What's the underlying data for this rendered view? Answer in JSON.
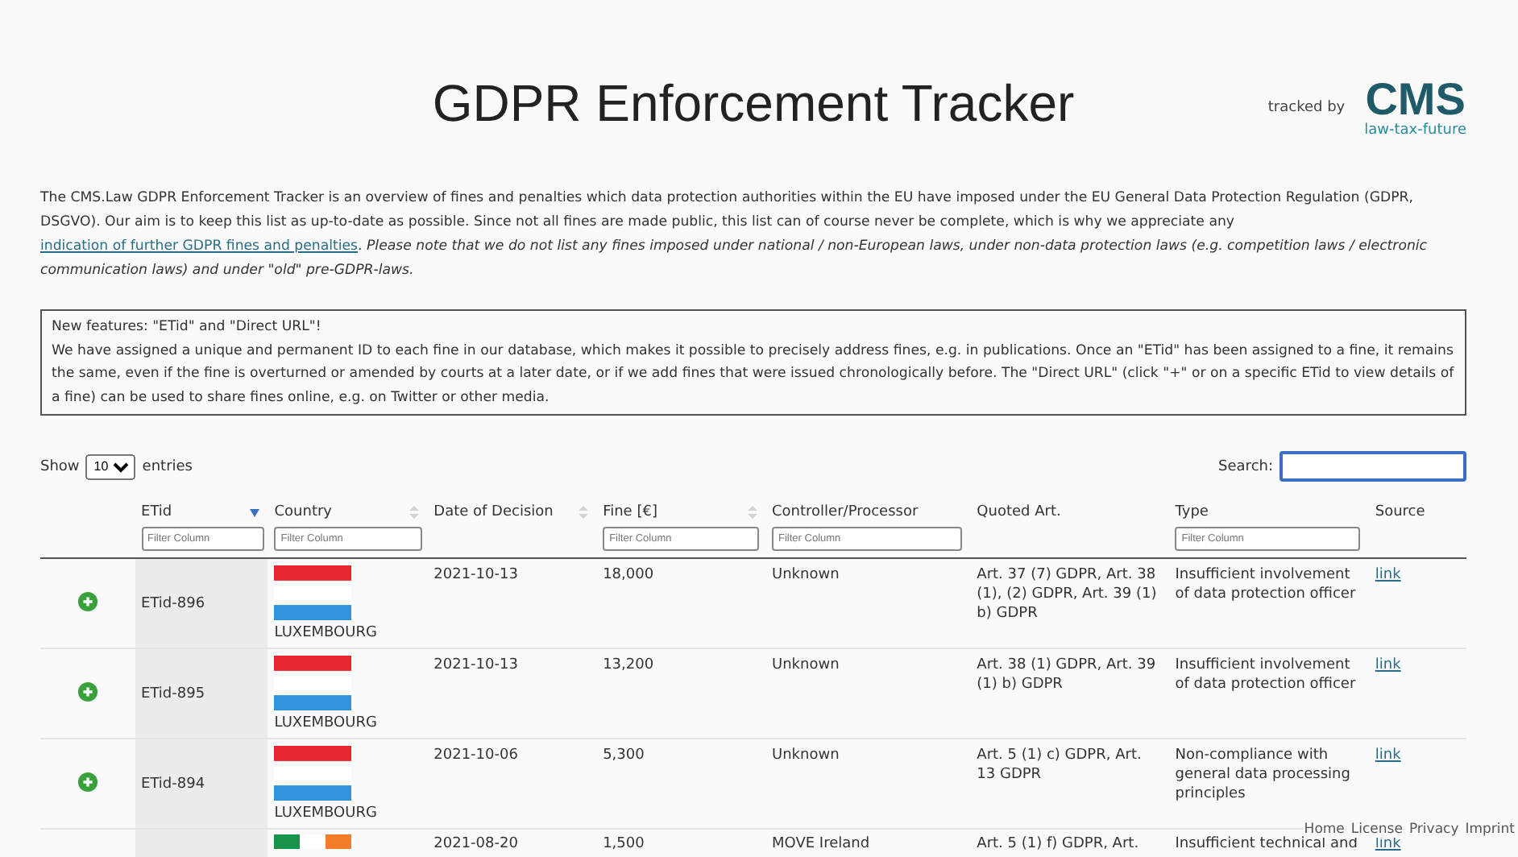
{
  "header": {
    "title": "GDPR Enforcement Tracker",
    "tracked_by": "tracked by",
    "logo": "CMS",
    "logo_tagline": "law-tax-future"
  },
  "intro": {
    "text": "The CMS.Law GDPR Enforcement Tracker is an overview of fines and penalties which data protection authorities within the EU have imposed under the EU General Data Protection Regulation (GDPR, DSGVO). Our aim is to keep this list as up-to-date as possible. Since not all fines are made public, this list can of course never be complete, which is why we appreciate any ",
    "link": "indication of further GDPR fines and penalties",
    "after": ".",
    "note": "Please note that we do not list any fines imposed under national / non-European laws, under non-data protection laws (e.g. competition laws / electronic communication laws) and under \"old\" pre-GDPR-laws."
  },
  "notice": {
    "title": "New features: \"ETid\" and \"Direct URL\"!",
    "text": "We have assigned a unique and permanent ID to each fine in our database, which makes it possible to precisely address fines, e.g. in publications. Once an \"ETid\" has been assigned to a fine, it remains the same, even if the fine is overturned or amended by courts at a later date, or if we add fines that were issued chronologically before. The \"Direct URL\" (click \"+\" or on a specific ETid to view details of a fine) can be used to share fines online, e.g. on Twitter or other media."
  },
  "length": {
    "show": "Show",
    "value": "10",
    "entries": "entries"
  },
  "search": {
    "label": "Search:"
  },
  "table": {
    "columns": [
      {
        "label": "ETid",
        "kind": "sorted",
        "placeholder": "Filter Column"
      },
      {
        "label": "Country",
        "kind": "sortable",
        "placeholder": "Filter Column"
      },
      {
        "label": "Date of Decision",
        "kind": "sortable"
      },
      {
        "label": "Fine [€]",
        "kind": "sortable",
        "placeholder": "Filter Column"
      },
      {
        "label": "Controller/Processor",
        "kind": "plain",
        "placeholder": "Filter Column"
      },
      {
        "label": "Quoted Art.",
        "kind": "plain"
      },
      {
        "label": "Type",
        "kind": "plain",
        "placeholder": "Filter Column"
      },
      {
        "label": "Source",
        "kind": "plain"
      }
    ],
    "rows": [
      {
        "etid": "ETid-896",
        "flag": {
          "kind": "horizontal",
          "stripes": [
            {
              "color": "#e8282f"
            },
            {
              "color": "#ffffff"
            },
            {
              "color": "#2f94dc"
            }
          ]
        },
        "country": "LUXEMBOURG",
        "date": "2021-10-13",
        "fine": "18,000",
        "controller": "Unknown",
        "quoted": "Art. 37 (7) GDPR, Art. 38 (1), (2) GDPR, Art. 39 (1) b) GDPR",
        "type": "Insufficient involvement of data protection officer",
        "source": "link"
      },
      {
        "etid": "ETid-895",
        "flag": {
          "kind": "horizontal",
          "stripes": [
            {
              "color": "#e8282f"
            },
            {
              "color": "#ffffff"
            },
            {
              "color": "#2f94dc"
            }
          ]
        },
        "country": "LUXEMBOURG",
        "date": "2021-10-13",
        "fine": "13,200",
        "controller": "Unknown",
        "quoted": "Art. 38 (1) GDPR, Art. 39 (1) b) GDPR",
        "type": "Insufficient involvement of data protection officer",
        "source": "link"
      },
      {
        "etid": "ETid-894",
        "flag": {
          "kind": "horizontal",
          "stripes": [
            {
              "color": "#e8282f"
            },
            {
              "color": "#ffffff"
            },
            {
              "color": "#2f94dc"
            }
          ]
        },
        "country": "LUXEMBOURG",
        "date": "2021-10-06",
        "fine": "5,300",
        "controller": "Unknown",
        "quoted": "Art. 5 (1) c) GDPR, Art. 13 GDPR",
        "type": "Non-compliance with general data processing principles",
        "source": "link"
      },
      {
        "flag": {
          "kind": "vertical",
          "stripes": [
            {
              "color": "#17934a"
            },
            {
              "color": "#ffffff"
            },
            {
              "color": "#f47d29"
            }
          ]
        },
        "date": "2021-08-20",
        "fine": "1,500",
        "controller": "MOVE Ireland",
        "quoted": "Art. 5 (1) f) GDPR, Art.",
        "type": "Insufficient technical and",
        "source": "link"
      }
    ]
  },
  "footer": [
    "Home",
    "License",
    "Privacy",
    "Imprint"
  ]
}
